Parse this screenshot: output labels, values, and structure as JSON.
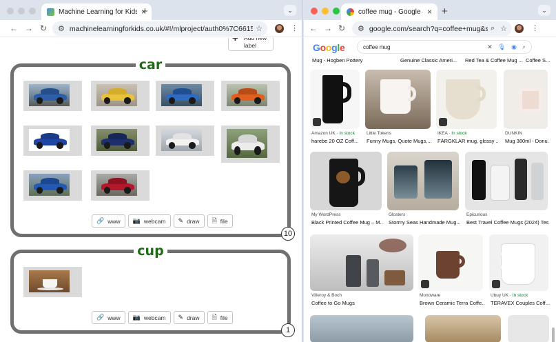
{
  "left_window": {
    "tab": {
      "title": "Machine Learning for Kids",
      "close": "×"
    },
    "new_tab": "+",
    "tab_menu": "⌄",
    "url": "machinelearningforkids.co.uk/#!/mlproject/auth0%7C6615cad78d...",
    "add_label_button": {
      "icon": "+",
      "label": "Add new label"
    },
    "buckets": [
      {
        "name": "car",
        "count": "10",
        "images": [
          "blue hatchback",
          "yellow hatchback",
          "blue car motion",
          "orange SUV",
          "blue compact",
          "dark blue SUV",
          "white SUV road",
          "white SUV",
          "blue crossover",
          "red SUV"
        ],
        "buttons": [
          "www",
          "webcam",
          "draw",
          "file"
        ]
      },
      {
        "name": "cup",
        "count": "1",
        "images": [
          "white cup"
        ],
        "buttons": [
          "www",
          "webcam",
          "draw",
          "file"
        ]
      }
    ]
  },
  "right_window": {
    "tab": {
      "title": "coffee mug - Google Search",
      "close": "×"
    },
    "new_tab": "+",
    "tab_menu": "⌄",
    "url": "google.com/search?q=coffee+mug&sc...",
    "logo": "Google",
    "query": "coffee mug",
    "top_strip": [
      {
        "title": "Mug - Hogben Pottery"
      },
      {
        "title": "Genuine Classic Ameri..."
      },
      {
        "title": "Red Tea & Coffee Mug ..."
      },
      {
        "title": "Coffee S..."
      }
    ],
    "rows": [
      [
        {
          "source": "Amazon UK",
          "stock": "In stock",
          "title": "harebe 20 OZ Coff...",
          "color": "#111111"
        },
        {
          "source": "Little Tokens",
          "stock": "",
          "title": "Funny Mugs, Quote Mugs,...",
          "color": "#f3f0ee"
        },
        {
          "source": "IKEA",
          "stock": "In stock",
          "title": "FÄRGKLAR mug, glossy ...",
          "color": "#e9e3d6"
        },
        {
          "source": "DUNKIN",
          "stock": "",
          "title": "Mug 380ml - Donu...",
          "color": "#e8e1dc"
        }
      ],
      [
        {
          "source": "My WordPress",
          "stock": "",
          "title": "Black Printed Coffee Mug – M...",
          "color": "#1b1b1b"
        },
        {
          "source": "Glosters",
          "stock": "",
          "title": "Stormy Seas Handmade Mug...",
          "color": "#3c4850"
        },
        {
          "source": "Epicurious",
          "stock": "",
          "title": "Best Travel Coffee Mugs (2024) Tes...",
          "color": "#cfcfcf"
        }
      ],
      [
        {
          "source": "Villeroy & Boch",
          "stock": "",
          "title": "Coffee to Go Mugs",
          "color": "#9a9a9a"
        },
        {
          "source": "Monoware",
          "stock": "",
          "title": "Brown Ceramic Terra Coffe...",
          "color": "#6b4330"
        },
        {
          "source": "Ubuy UK",
          "stock": "In stock",
          "title": "TERAVEX Couples Coff...",
          "color": "#f4f4f4"
        }
      ]
    ]
  }
}
